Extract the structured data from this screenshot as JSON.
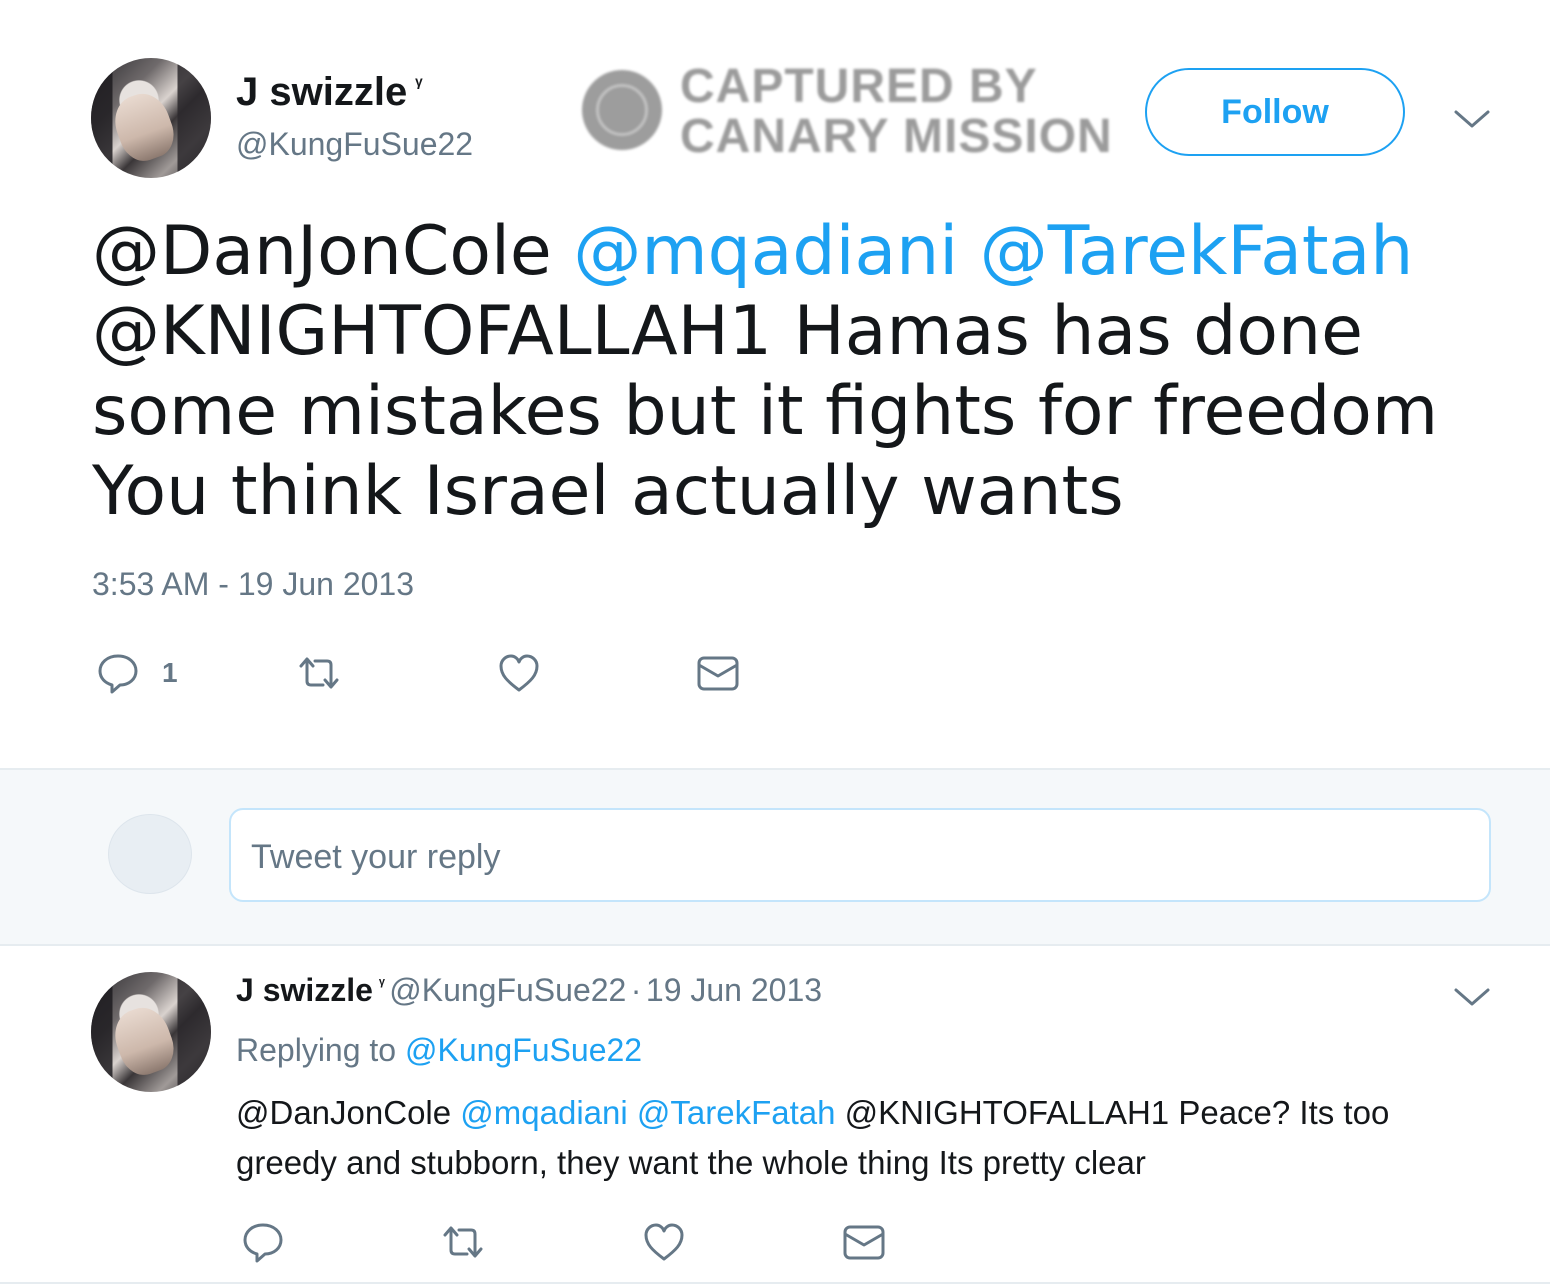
{
  "main_tweet": {
    "author": {
      "name": "J swizzle",
      "badge": "ᵞ",
      "handle": "@KungFuSue22"
    },
    "watermark": {
      "line1": "CAPTURED BY",
      "line2": "CANARY MISSION"
    },
    "follow_label": "Follow",
    "text": {
      "mention1": "@DanJonCole",
      "mention2": "@mqadiani",
      "mention3": "@TarekFatah",
      "mention4": "@KNIGHTOFALLAH1",
      "body": "Hamas has done some mistakes but it fights for freedom You think Israel actually wants"
    },
    "timestamp": "3:53 AM - 19 Jun 2013",
    "actions": {
      "reply_count": "1"
    }
  },
  "compose": {
    "placeholder": "Tweet your reply"
  },
  "reply_tweet": {
    "author": {
      "name": "J swizzle",
      "badge": "ᵞ",
      "handle": "@KungFuSue22",
      "separator": "·",
      "date": "19 Jun 2013"
    },
    "replying_prefix": "Replying to",
    "replying_handle": "@KungFuSue22",
    "text": {
      "mention1": "@DanJonCole",
      "mention2": "@mqadiani",
      "mention3": "@TarekFatah",
      "mention4": "@KNIGHTOFALLAH1",
      "body": "Peace? Its too greedy and stubborn, they want the whole thing Its pretty clear"
    }
  },
  "colors": {
    "accent": "#1da1f2",
    "secondary_text": "#657786",
    "primary_text": "#14171a",
    "compose_background": "#f5f8fa"
  },
  "icons": [
    "reply-icon",
    "retweet-icon",
    "like-icon",
    "direct-message-icon",
    "chevron-down-icon"
  ]
}
